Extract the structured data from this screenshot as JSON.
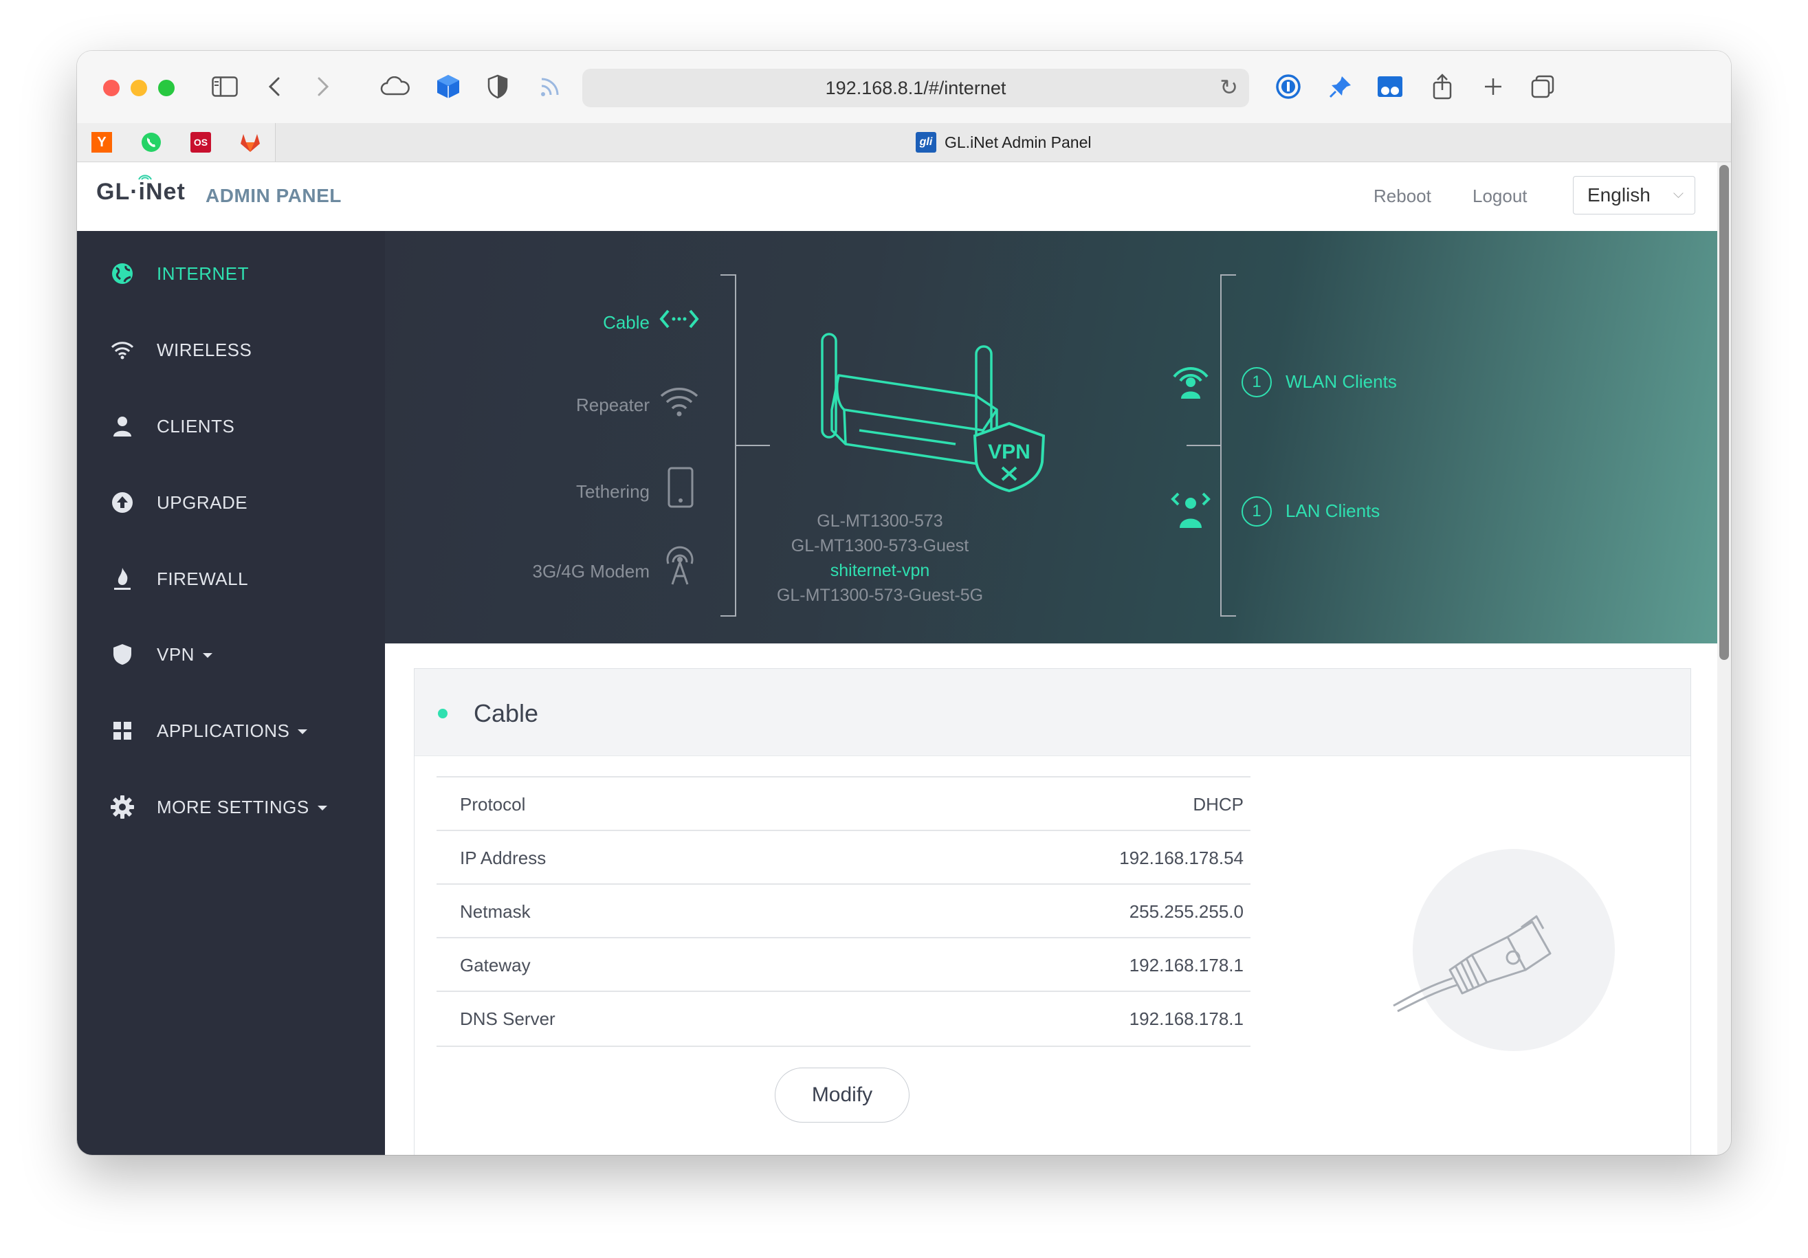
{
  "browser": {
    "url": "192.168.8.1/#/internet",
    "tab_title": "GL.iNet Admin Panel",
    "favicons": [
      "y-combinator-icon",
      "whatsapp-icon",
      "lastpass-icon",
      "gitlab-icon"
    ]
  },
  "header": {
    "logo": "GL·iNet",
    "admin_panel": "ADMIN PANEL",
    "reboot": "Reboot",
    "logout": "Logout",
    "language": "English"
  },
  "sidebar": {
    "items": [
      {
        "label": "INTERNET",
        "icon": "globe-icon"
      },
      {
        "label": "WIRELESS",
        "icon": "wifi-icon"
      },
      {
        "label": "CLIENTS",
        "icon": "user-icon"
      },
      {
        "label": "UPGRADE",
        "icon": "upgrade-icon"
      },
      {
        "label": "FIREWALL",
        "icon": "firewall-icon"
      },
      {
        "label": "VPN",
        "icon": "shield-icon"
      },
      {
        "label": "APPLICATIONS",
        "icon": "grid-icon"
      },
      {
        "label": "MORE SETTINGS",
        "icon": "gear-icon"
      }
    ]
  },
  "hero": {
    "sources": [
      "Cable",
      "Repeater",
      "Tethering",
      "3G/4G Modem"
    ],
    "device_badge": "VPN",
    "ssids": [
      "GL-MT1300-573",
      "GL-MT1300-573-Guest",
      "shiternet-vpn",
      "GL-MT1300-573-Guest-5G"
    ],
    "wlan_count": "1",
    "wlan_label": "WLAN Clients",
    "lan_count": "1",
    "lan_label": "LAN Clients"
  },
  "cable": {
    "title": "Cable",
    "rows": [
      {
        "key": "Protocol",
        "value": "DHCP"
      },
      {
        "key": "IP Address",
        "value": "192.168.178.54"
      },
      {
        "key": "Netmask",
        "value": "255.255.255.0"
      },
      {
        "key": "Gateway",
        "value": "192.168.178.1"
      },
      {
        "key": "DNS Server",
        "value": "192.168.178.1"
      }
    ],
    "modify": "Modify"
  },
  "colors": {
    "accent": "#2fe0b0",
    "sidebar": "#2b2f3c"
  }
}
